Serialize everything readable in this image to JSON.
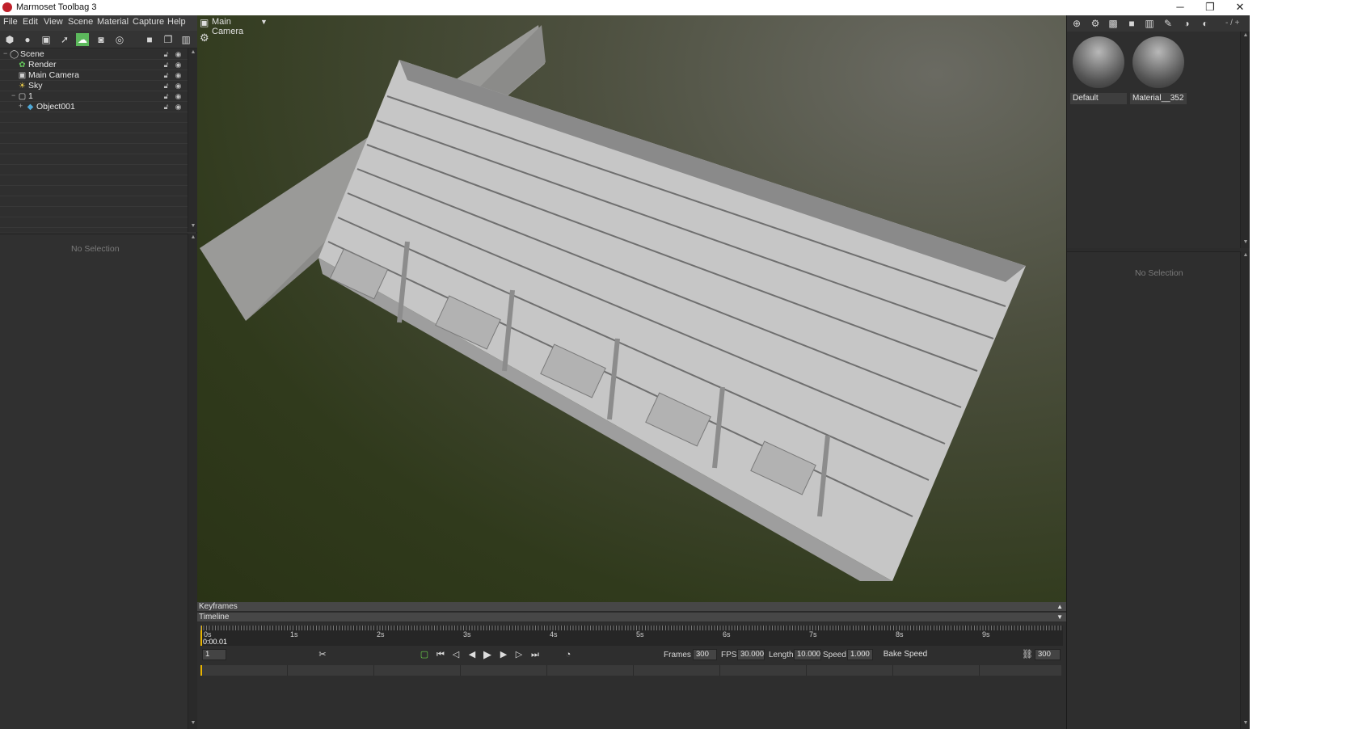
{
  "window": {
    "title": "Marmoset Toolbag 3",
    "controls": [
      "─",
      "❐",
      "✕"
    ]
  },
  "menu": [
    "File",
    "Edit",
    "View",
    "Scene",
    "Material",
    "Capture",
    "Help"
  ],
  "scene_tree": {
    "items": [
      {
        "label": "Scene",
        "icon": "scene-icon"
      },
      {
        "label": "Render",
        "icon": "render-icon"
      },
      {
        "label": "Main Camera",
        "icon": "camera-icon"
      },
      {
        "label": "Sky",
        "icon": "sky-icon"
      },
      {
        "label": "1",
        "icon": "group-icon"
      },
      {
        "label": "Object001",
        "icon": "mesh-icon"
      }
    ]
  },
  "left_properties": {
    "empty_text": "No Selection"
  },
  "viewport": {
    "camera_label": "Main Camera"
  },
  "timeline": {
    "keyframes_label": "Keyframes",
    "timeline_label": "Timeline",
    "seconds": [
      "0s",
      "1s",
      "2s",
      "3s",
      "4s",
      "5s",
      "6s",
      "7s",
      "8s",
      "9s"
    ],
    "current_time": "0:00.01",
    "frame_field": "1",
    "frames_label": "Frames",
    "frames_value": "300",
    "fps_label": "FPS",
    "fps_value": "30.000",
    "length_label": "Length",
    "length_value": "10.000",
    "speed_label": "Speed",
    "speed_value": "1.000",
    "bake_label": "Bake Speed",
    "end_frame": "300"
  },
  "materials": {
    "items": [
      {
        "label": "Default"
      },
      {
        "label": "Material__352"
      }
    ],
    "page_indicator": "- / +"
  },
  "right_properties": {
    "empty_text": "No Selection"
  }
}
